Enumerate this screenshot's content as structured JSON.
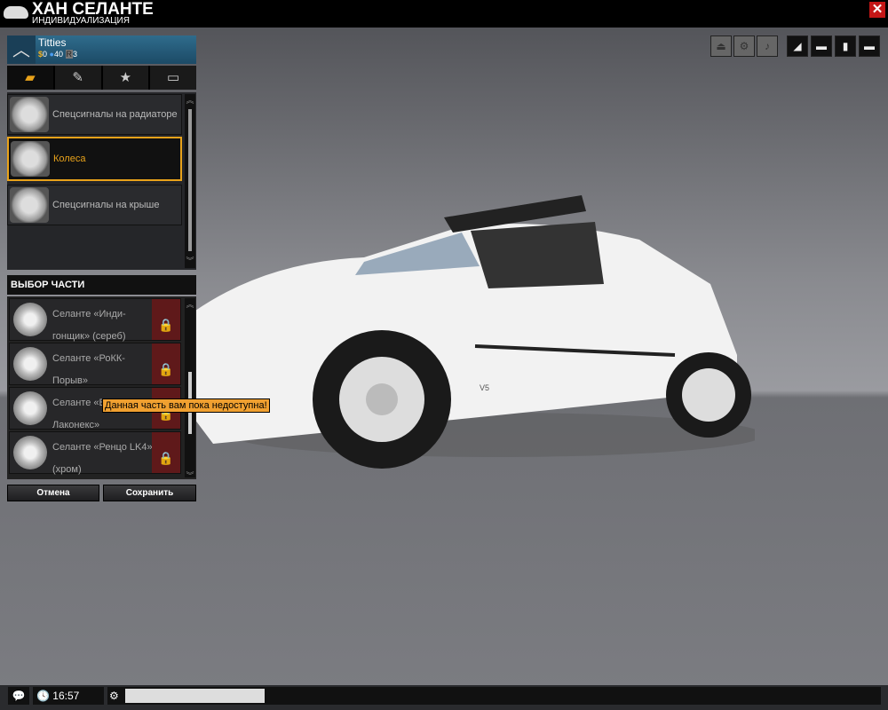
{
  "header": {
    "title": "ХАН СЕЛАНТЕ",
    "subtitle": "ИНДИВИДУАЛИЗАЦИЯ"
  },
  "profile": {
    "name": "Titties",
    "money": "0",
    "points": "40",
    "rank_label": "R",
    "rank": "3"
  },
  "tabs": [
    {
      "icon": "door-icon"
    },
    {
      "icon": "brush-icon"
    },
    {
      "icon": "star-icon",
      "glyph": "★"
    },
    {
      "icon": "plate-icon"
    }
  ],
  "categories": [
    {
      "label": "Спецсигналы на радиаторе"
    },
    {
      "label": "Колеса"
    },
    {
      "label": "Спецсигналы на крыше"
    }
  ],
  "parts_header": "ВЫБОР ЧАСТИ",
  "parts": [
    {
      "line1": "Селанте «Инди-",
      "line2": "гонщик» (сереб)"
    },
    {
      "line1": "Селанте «РоКК-",
      "line2": "Порыв»"
    },
    {
      "line1": "Селанте «Бризио-",
      "line2": "Лаконекс»"
    },
    {
      "line1": "Селанте «Ренцо LK4»",
      "line2": "(хром)"
    }
  ],
  "tooltip": "Данная часть вам пока недоступна!",
  "buttons": {
    "cancel": "Отмена",
    "save": "Сохранить"
  },
  "clock": "16:57",
  "car_plate": "V5"
}
